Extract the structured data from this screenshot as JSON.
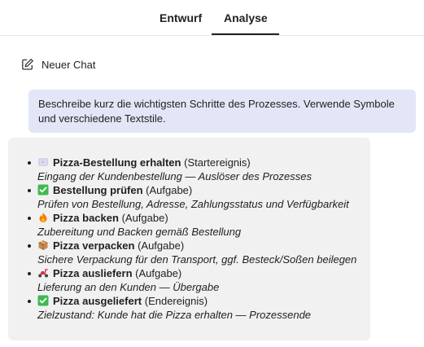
{
  "tabs": [
    {
      "label": "Entwurf",
      "active": false
    },
    {
      "label": "Analyse",
      "active": true
    }
  ],
  "new_chat": {
    "label": "Neuer Chat",
    "icon": "edit-icon"
  },
  "user_message": "Beschreibe kurz die wichtigsten Schritte des Prozesses. Verwende Symbole und verschiedene Textstile.",
  "steps": [
    {
      "icon": "receipt-icon",
      "title": "Pizza-Bestellung erhalten",
      "type": "(Startereignis)",
      "description": "Eingang der Kundenbestellung — Auslöser des Prozesses"
    },
    {
      "icon": "check-icon",
      "title": "Bestellung prüfen",
      "type": "(Aufgabe)",
      "description": "Prüfen von Bestellung, Adresse, Zahlungsstatus und Verfügbarkeit"
    },
    {
      "icon": "fire-icon",
      "title": "Pizza backen",
      "type": "(Aufgabe)",
      "description": "Zubereitung und Backen gemäß Bestellung"
    },
    {
      "icon": "package-icon",
      "title": "Pizza verpacken",
      "type": "(Aufgabe)",
      "description": "Sichere Verpackung für den Transport, ggf. Besteck/Soßen beilegen"
    },
    {
      "icon": "scooter-icon",
      "title": "Pizza ausliefern",
      "type": "(Aufgabe)",
      "description": "Lieferung an den Kunden — Übergabe"
    },
    {
      "icon": "check-icon",
      "title": "Pizza ausgeliefert",
      "type": "(Endereignis)",
      "description": "Zielzustand: Kunde hat die Pizza erhalten — Prozessende"
    }
  ],
  "colors": {
    "user_bubble": "#e3e6f6",
    "answer_bg": "#f1f1f1",
    "check_green": "#3fb950",
    "fire_orange": "#f57c00",
    "package_brown": "#a0673a",
    "scooter_red": "#d8334a"
  }
}
